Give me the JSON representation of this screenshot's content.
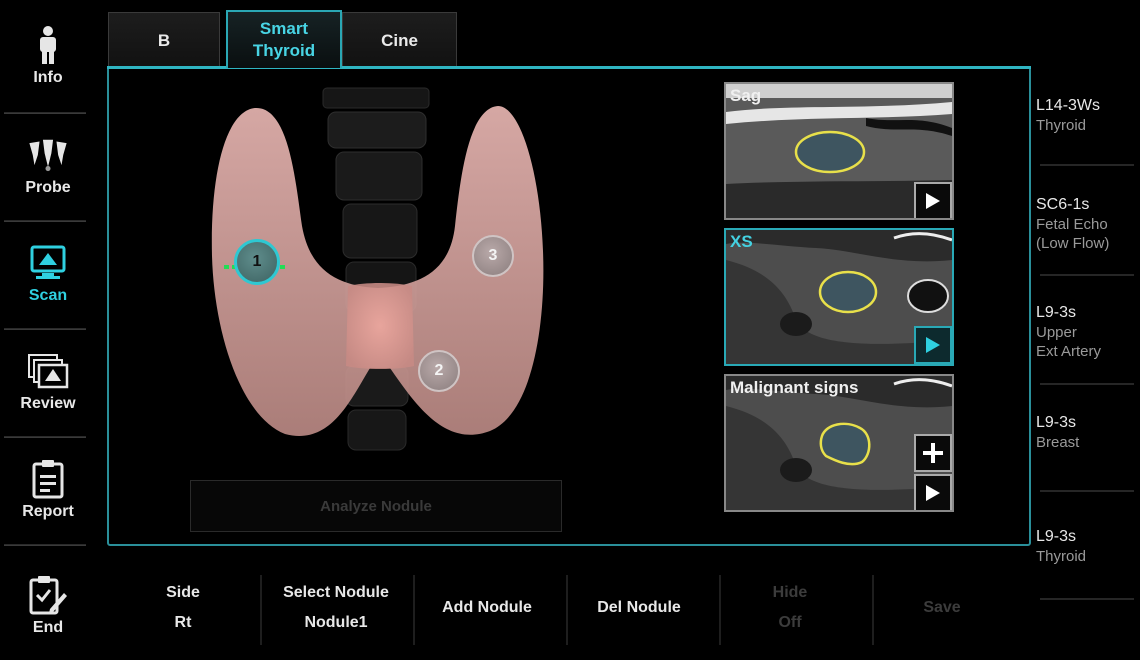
{
  "sidebar": {
    "items": [
      {
        "label": "Info",
        "icon": "person-icon"
      },
      {
        "label": "Probe",
        "icon": "probe-icon"
      },
      {
        "label": "Scan",
        "icon": "scan-icon",
        "active": true
      },
      {
        "label": "Review",
        "icon": "review-icon"
      },
      {
        "label": "Report",
        "icon": "report-icon"
      },
      {
        "label": "End",
        "icon": "end-icon"
      }
    ]
  },
  "tabs": [
    {
      "label": "B"
    },
    {
      "label": "Smart Thyroid",
      "active": true
    },
    {
      "label": "Cine"
    }
  ],
  "diagram": {
    "nodules": [
      {
        "label": "1",
        "active": true
      },
      {
        "label": "2"
      },
      {
        "label": "3"
      }
    ]
  },
  "analyze_button": "Analyze Nodule",
  "thumbnails": [
    {
      "title": "Sag"
    },
    {
      "title": "XS",
      "selected": true
    },
    {
      "title": "Malignant signs"
    }
  ],
  "probes": [
    {
      "name": "L14-3Ws",
      "sub": [
        "Thyroid"
      ]
    },
    {
      "name": "SC6-1s",
      "sub": [
        "Fetal Echo",
        "(Low Flow)"
      ]
    },
    {
      "name": "L9-3s",
      "sub": [
        "Upper",
        "Ext Artery"
      ]
    },
    {
      "name": "L9-3s",
      "sub": [
        "Breast"
      ]
    },
    {
      "name": "L9-3s",
      "sub": [
        "Thyroid"
      ]
    }
  ],
  "controls": [
    {
      "label": "Side",
      "value": "Rt",
      "enabled": true
    },
    {
      "label": "Select Nodule",
      "value": "Nodule1",
      "enabled": true
    },
    {
      "label": "Add Nodule",
      "value": "",
      "enabled": true
    },
    {
      "label": "Del Nodule",
      "value": "",
      "enabled": true
    },
    {
      "label": "Hide",
      "value": "Off",
      "enabled": false
    },
    {
      "label": "Save",
      "value": "",
      "enabled": false
    }
  ],
  "colors": {
    "accent": "#2fd0e0",
    "panel_border": "#2a8f9a",
    "nodule_outline": "#e8e04a",
    "thyroid": "#e9b6b2"
  }
}
